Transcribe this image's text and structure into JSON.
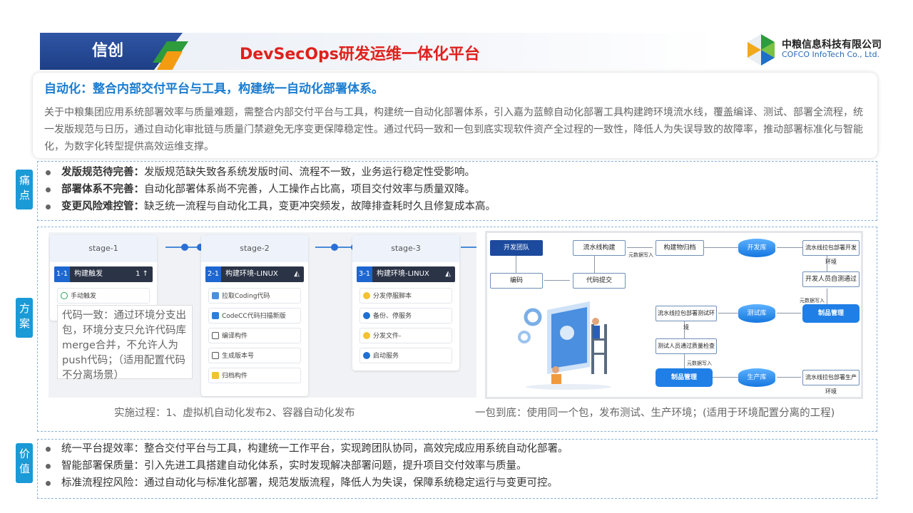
{
  "header": {
    "tag": "信创",
    "title": "DevSecOps研发运维一体化平台",
    "company_cn": "中粮信息科技有限公司",
    "company_en": "COFCO InfoTech Co., Ltd.",
    "colors": {
      "tag": "#2f55a4",
      "title": "#e0201c",
      "accent_green": "#2e9b3d",
      "accent_orange": "#f39c12"
    }
  },
  "intro": {
    "title": "自动化：整合内部交付平台与工具，构建统一自动化部署体系。",
    "text": "关于中粮集团应用系统部署效率与质量难题，需整合内部交付平台与工具，构建统一自动化部署体系，引入嘉为蓝鲸自动化部署工具构建跨环境流水线，覆盖编译、测试、部署全流程，统一发版规范与日历，通过自动化审批链与质量门禁避免无序变更保障稳定性。通过代码一致和一包到底实现软件资产全过程的一致性，降低人为失误导致的故障率，推动部署标准化与智能化，为数字化转型提供高效运维支撑。"
  },
  "pain": {
    "label": "痛点",
    "items": [
      {
        "head": "发版规范待完善：",
        "text": "发版规范缺失致各系统发版时间、流程不一致，业务运行稳定性受影响。"
      },
      {
        "head": "部署体系不完善：",
        "text": "自动化部署体系尚不完善，人工操作占比高，项目交付效率与质量双降。"
      },
      {
        "head": "变更风险难控管：",
        "text": "缺乏统一流程与自动化工具，变更冲突频发，故障排查耗时久且修复成本高。"
      }
    ]
  },
  "solution": {
    "label": "方案",
    "stages": [
      {
        "name": "stage-1",
        "job_num": "1-1",
        "job": "构建触发",
        "job_right": "1 ↑",
        "tasks": [
          "手动触发"
        ]
      },
      {
        "name": "stage-2",
        "job_num": "2-1",
        "job": "构建环境-LINUX",
        "job_right": "",
        "tasks": [
          "拉取Coding代码",
          "CodeCC代码扫描新版",
          "编译构件",
          "生成版本号",
          "归档构件"
        ]
      },
      {
        "name": "stage-3",
        "job_num": "3-1",
        "job": "构建环境-LINUX",
        "job_right": "",
        "tasks": [
          "分发停服脚本",
          "备份、停服务",
          "分发文件-",
          "启动服务"
        ]
      }
    ],
    "callout": "代码一致：通过环境分支出包，环境分支只允许代码库merge合并，不允许人为push代码；（适用配置代码不分离场景）",
    "caption_left": "实施过程：1、虚拟机自动化发布2、容器自动化发布",
    "caption_right": "一包到底：使用同一个包，发布测试、生产环境；(适用于环境配置分离的工程)",
    "flow": {
      "dev_team": "开发团队",
      "coding": "编码",
      "pipeline_build": "流水线构建",
      "code_commit": "代码提交",
      "artifact_archive": "构建物归档",
      "dev_repo": "开发库",
      "pull_dev": "流水线拉包部署开发环境",
      "dev_self_test": "开发人员自测通过",
      "metadata_write": "元数据写入",
      "product_mgmt": "制品管理",
      "test_repo": "测试库",
      "pull_test": "流水线拉包部署测试环境",
      "tester_check": "测试人员通过质量检查",
      "prod_repo": "生产库",
      "pull_prod": "流水线拉包部署生产环境"
    }
  },
  "value": {
    "label": "价值",
    "items": [
      {
        "head": "统一平台提效率：",
        "text": "整合交付平台与工具，构建统一工作平台，实现跨团队协同，高效完成应用系统自动化部署。"
      },
      {
        "head": "智能部署保质量：",
        "text": "引入先进工具搭建自动化体系，实时发现解决部署问题，提升项目交付效率与质量。"
      },
      {
        "head": "标准流程控风险：",
        "text": "通过自动化与标准化部署，规范发版流程，降低人为失误，保障系统稳定运行与变更可控。"
      }
    ]
  }
}
